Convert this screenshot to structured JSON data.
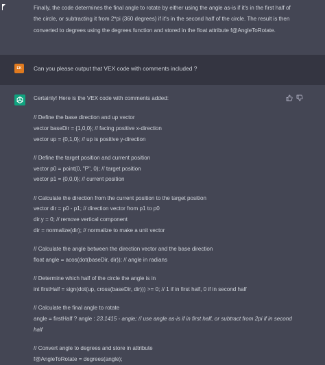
{
  "previous_message": {
    "text": "Finally, the code determines the final angle to rotate by either using the angle as-is if it's in the first half of the circle, or subtracting it from 2*pi (360 degrees) if it's in the second half of the circle. The result is then converted to degrees using the degrees function and stored in the float attribute f@AngleToRotate."
  },
  "user_message": {
    "avatar_initials": "EK",
    "text": "Can you please output that VEX code with comments included ?"
  },
  "assistant_message": {
    "intro": "Certainly! Here is the VEX code with comments added:",
    "code_blocks": [
      [
        "// Define the base direction and up vector",
        "vector baseDir = {1,0,0}; // facing positive x-direction",
        "vector up = {0,1,0}; // up is positive y-direction"
      ],
      [
        "// Define the target position and current position",
        "vector p0 = point(0, \"P\", 0); // target position",
        "vector p1 = {0,0,0}; // current position"
      ],
      [
        "// Calculate the direction from the current position to the target position",
        "vector dir = p0 - p1; // direction vector from p1 to p0",
        "dir.y = 0; // remove vertical component",
        "dir = normalize(dir); // normalize to make a unit vector"
      ],
      [
        "// Calculate the angle between the direction vector and the base direction",
        "float angle = acos(dot(baseDir, dir)); // angle in radians"
      ],
      [
        "// Determine which half of the circle the angle is in",
        "int firstHalf = sign(dot(up, cross(baseDir, dir))) >= 0; // 1 if in first half, 0 if in second half"
      ],
      [
        "// Calculate the final angle to rotate"
      ],
      [
        "// Convert angle to degrees and store in attribute",
        "f@AngleToRotate = degrees(angle);"
      ]
    ],
    "final_angle_line": {
      "prefix": "angle = firstHalf ? angle : ",
      "italic": "23.1415 - angle; // use angle as-is if in first half, or subtract from 2pi if in second half"
    }
  },
  "icons": {
    "thumbs_up": "thumbs-up-icon",
    "thumbs_down": "thumbs-down-icon",
    "assistant_logo": "openai-logo-icon",
    "cursor": "mouse-cursor-icon"
  },
  "colors": {
    "assistant_bg": "#444654",
    "user_bg": "#343541",
    "text": "#d1d5db",
    "user_avatar": "#e07a1f",
    "assistant_avatar": "#10a37f"
  }
}
